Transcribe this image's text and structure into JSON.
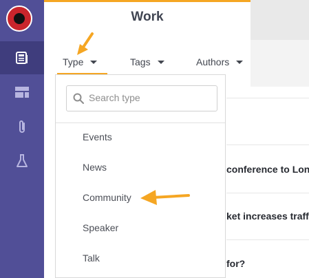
{
  "header": {
    "title": "Work"
  },
  "filters": {
    "type_label": "Type",
    "tags_label": "Tags",
    "authors_label": "Authors"
  },
  "search": {
    "placeholder": "Search type"
  },
  "dropdown": {
    "options": [
      "Events",
      "News",
      "Community",
      "Speaker",
      "Talk"
    ]
  },
  "rows": {
    "items": [
      {
        "text": "conference to Lond"
      },
      {
        "text": "ket increases traffic"
      },
      {
        "text": "for?"
      }
    ]
  },
  "colors": {
    "sidebar": "#514f97",
    "accent": "#f5a623",
    "logo": "#c9252c"
  },
  "icons": [
    "logo",
    "newspaper-icon",
    "layout-icon",
    "paperclip-icon",
    "flask-icon",
    "search-icon",
    "caret-down-icon",
    "arrow-icon"
  ]
}
